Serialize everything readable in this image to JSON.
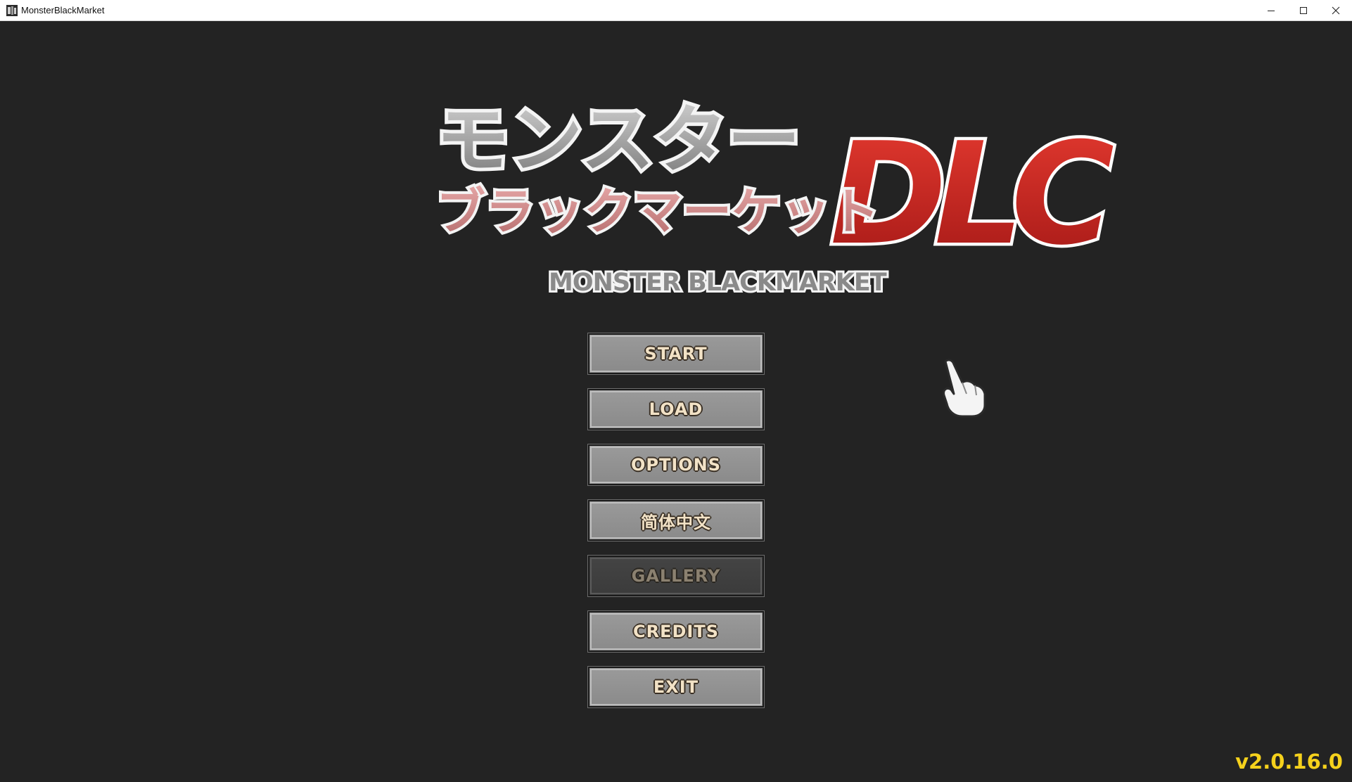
{
  "window": {
    "title": "MonsterBlackMarket",
    "controls": [
      "minimize-icon",
      "maximize-icon",
      "close-icon"
    ]
  },
  "logo": {
    "japanese_title_top": "モンスター",
    "japanese_title_bottom": "ブラックマーケット",
    "dlc": "DLC",
    "english_title": "MONSTER BLACKMARKET"
  },
  "menu": {
    "start": "START",
    "load": "LOAD",
    "options": "OPTIONS",
    "language": "简体中文",
    "gallery": "GALLERY",
    "credits": "CREDITS",
    "exit": "EXIT"
  },
  "version": "v2.0.16.0",
  "colors": {
    "background": "#232323",
    "button_face": "#8f8f8f",
    "button_text": "#f2e2c6",
    "disabled_button": "#3f3f3f",
    "version_text": "#f5d11c",
    "logo_red": "#d42a24",
    "logo_pink": "#d98e8e"
  }
}
